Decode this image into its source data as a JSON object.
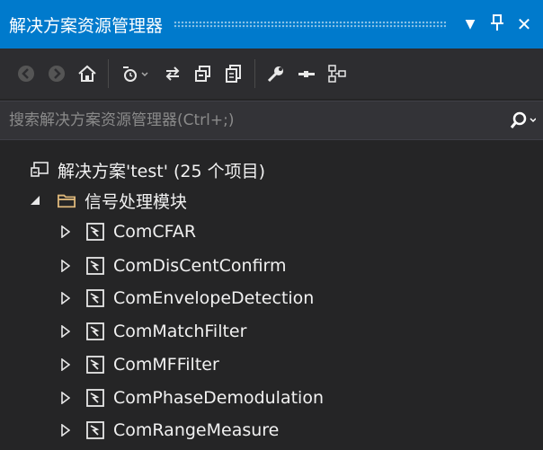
{
  "titlebar": {
    "title": "解决方案资源管理器",
    "dropdown_glyph": "▼",
    "pin_glyph": "ᛘ",
    "close_glyph": "✕"
  },
  "toolbar": {
    "buttons": [
      {
        "name": "back-icon"
      },
      {
        "name": "forward-icon"
      },
      {
        "name": "home-icon"
      },
      {
        "name": "sync-pending-icon"
      },
      {
        "name": "sync-with-document-icon"
      },
      {
        "name": "collapse-all-icon"
      },
      {
        "name": "show-all-files-icon"
      },
      {
        "name": "properties-wrench-icon"
      },
      {
        "name": "preview-selected-icon"
      },
      {
        "name": "class-view-icon"
      }
    ]
  },
  "search": {
    "placeholder": "搜索解决方案资源管理器(Ctrl+;)",
    "value": ""
  },
  "tree": {
    "solution": {
      "label": "解决方案'test' (25 个项目)"
    },
    "folder": {
      "label": "信号处理模块",
      "expanded": true
    },
    "projects": [
      {
        "label": "ComCFAR"
      },
      {
        "label": "ComDisCentConfirm"
      },
      {
        "label": "ComEnvelopeDetection"
      },
      {
        "label": "ComMatchFilter"
      },
      {
        "label": "ComMFFilter"
      },
      {
        "label": "ComPhaseDemodulation"
      },
      {
        "label": "ComRangeMeasure"
      }
    ]
  },
  "colors": {
    "accent": "#007acc",
    "background": "#252526",
    "text": "#f1f1f1",
    "folder": "#dcb67a"
  }
}
